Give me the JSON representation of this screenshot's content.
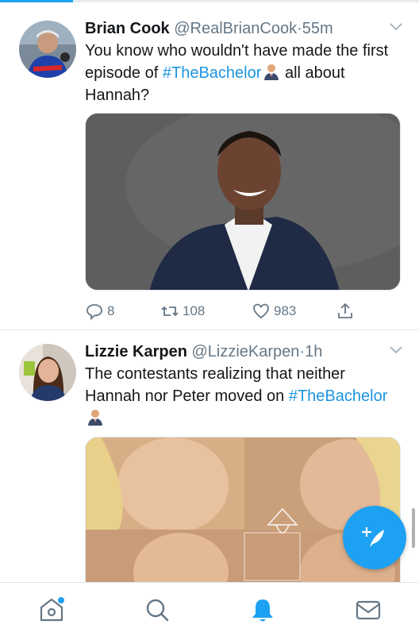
{
  "tweets": [
    {
      "name": "Brian Cook",
      "handle": "@RealBrianCook",
      "dot": "·",
      "time": "55m",
      "text_before": "You know who wouldn't have made the first episode of ",
      "hashtag": "#TheBachelor",
      "text_after": " all about Hannah?",
      "counts": {
        "reply": "8",
        "retweet": "108",
        "like": "983"
      }
    },
    {
      "name": "Lizzie Karpen",
      "handle": "@LizzieKarpen",
      "dot": "·",
      "time": "1h",
      "text_before": "The contestants realizing that neither Hannah nor Peter moved on ",
      "hashtag": "#TheBachelor",
      "text_after": ""
    }
  ],
  "icons": {
    "reply": "reply-icon",
    "retweet": "retweet-icon",
    "like": "heart-icon",
    "share": "share-icon",
    "compose": "compose-tweet-icon",
    "tabs": [
      "home-icon",
      "search-icon",
      "notifications-icon",
      "messages-icon"
    ]
  },
  "colors": {
    "accent": "#1da1f2",
    "hashtag": "#1b95e0",
    "muted": "#657786",
    "text": "#14171a"
  }
}
